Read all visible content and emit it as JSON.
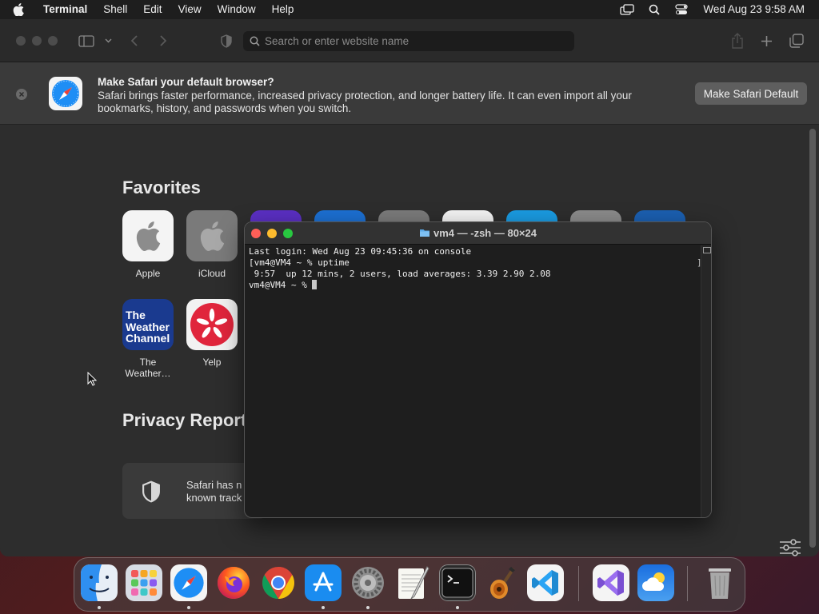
{
  "menubar": {
    "app_name": "Terminal",
    "items": [
      "Shell",
      "Edit",
      "View",
      "Window",
      "Help"
    ],
    "clock": "Wed Aug 23  9:58 AM",
    "status_icons": [
      "screen-mirroring-icon",
      "spotlight-search-icon",
      "control-center-icon"
    ]
  },
  "safari": {
    "address_placeholder": "Search or enter website name",
    "banner": {
      "title": "Make Safari your default browser?",
      "text": "Safari brings faster performance, increased privacy protection, and longer battery life. It can even import all your bookmarks, history, and passwords when you switch.",
      "button": "Make Safari Default"
    },
    "favorites_title": "Favorites",
    "favorites": [
      {
        "label": "Apple"
      },
      {
        "label": "iCloud"
      },
      {
        "label": "The Weather…",
        "tile_text": "The Weather Channel"
      },
      {
        "label": "Yelp"
      }
    ],
    "privacy_title": "Privacy Report",
    "privacy_text": "Safari has n\nknown track"
  },
  "terminal": {
    "title": "vm4 — -zsh — 80×24",
    "lines": [
      "Last login: Wed Aug 23 09:45:36 on console",
      "[vm4@VM4 ~ % uptime",
      " 9:57  up 12 mins, 2 users, load averages: 3.39 2.90 2.08",
      "vm4@VM4 ~ % "
    ]
  },
  "dock": {
    "apps": [
      "Finder",
      "Launchpad",
      "Safari",
      "Firefox",
      "Chrome",
      "App Store",
      "System Settings",
      "TextEdit",
      "Terminal",
      "GarageBand",
      "Visual Studio Code",
      "Visual Studio",
      "Weather",
      "Trash"
    ]
  },
  "colors": {
    "close": "#ff5f57",
    "minimize": "#febc2e",
    "zoom": "#28c840",
    "safari_blue": "#1e8ef5",
    "weather_blue": "#1a3a8f",
    "yelp_red": "#e0253c"
  }
}
